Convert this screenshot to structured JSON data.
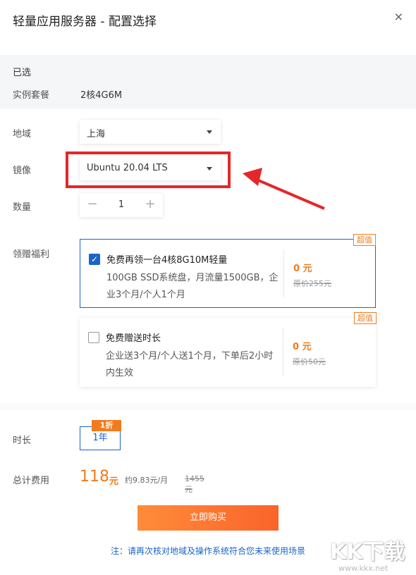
{
  "dialog": {
    "title": "轻量应用服务器 - 配置选择",
    "close_glyph": "×"
  },
  "selected": {
    "heading": "已选",
    "package_label": "实例套餐",
    "package_value": "2核4G6M"
  },
  "region": {
    "label": "地域",
    "value": "上海"
  },
  "image": {
    "label": "镜像",
    "value": "Ubuntu 20.04 LTS"
  },
  "quantity": {
    "label": "数量",
    "value": "1",
    "minus": "−",
    "plus": "+"
  },
  "benefits": {
    "label": "领赠福利",
    "items": [
      {
        "title": "免费再领一台4核8G10M轻量",
        "desc": "100GB SSD系统盘，月流量1500GB，企业3个月/个人1个月",
        "price": "0 元",
        "original": "原价255元",
        "badge": "超值",
        "checked": true
      },
      {
        "title": "免费赠送时长",
        "desc": "企业送3个月/个人送1个月，下单后2小时内生效",
        "price": "0 元",
        "original": "原价50元",
        "badge": "超值",
        "checked": false
      }
    ]
  },
  "duration": {
    "label": "时长",
    "option": "1年",
    "discount": "1折"
  },
  "total": {
    "label": "总计费用",
    "amount": "118",
    "unit": "元",
    "per_month": "约9.83元/月",
    "original": "1455元"
  },
  "buy_button": "立即购买",
  "note": "注：请再次核对地域及操作系统符合您未来使用场景",
  "watermark": {
    "letters": "KK下载",
    "url": "www.kkx.net"
  },
  "colors": {
    "accent": "#1a64c8",
    "orange": "#f37b1d",
    "highlight": "#e5262b"
  }
}
